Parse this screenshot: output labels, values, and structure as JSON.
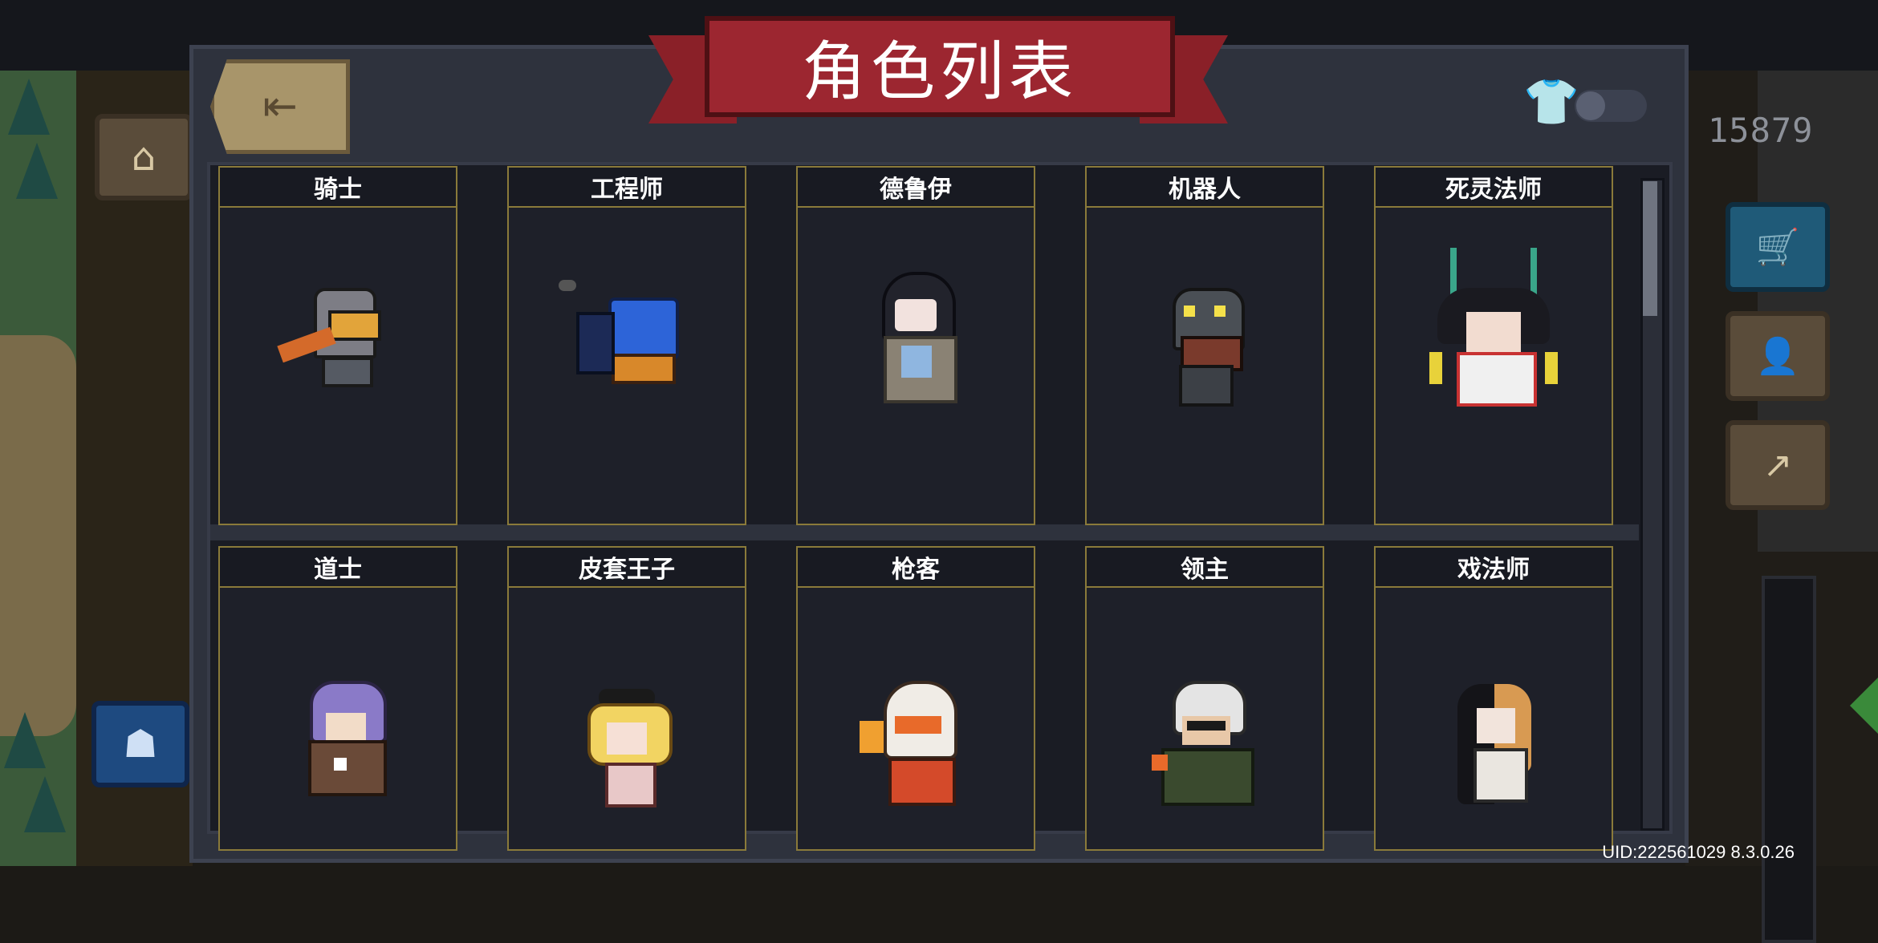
{
  "header": {
    "title": "角色列表",
    "back_icon": "exit-door-icon",
    "skin_toggle_icon": "shirt-icon",
    "skin_toggle_on": false
  },
  "hud": {
    "coins": "15879",
    "uid": "UID:222561029 8.3.0.26"
  },
  "characters": [
    {
      "name": "骑士"
    },
    {
      "name": "工程师"
    },
    {
      "name": "德鲁伊"
    },
    {
      "name": "机器人"
    },
    {
      "name": "死灵法师"
    },
    {
      "name": "道士"
    },
    {
      "name": "皮套王子"
    },
    {
      "name": "枪客"
    },
    {
      "name": "领主"
    },
    {
      "name": "戏法师"
    }
  ],
  "scrollbar": {
    "position": 0.0
  }
}
